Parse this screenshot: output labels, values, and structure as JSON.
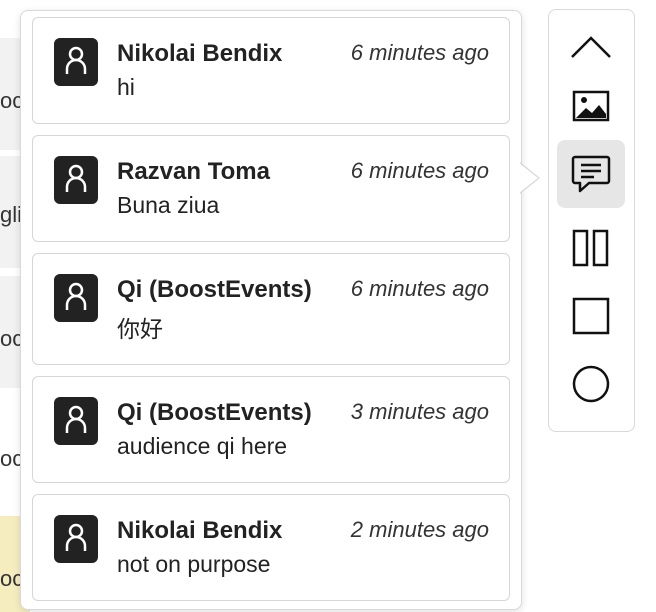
{
  "background": {
    "rows": [
      "oc",
      "gli",
      "oc",
      "oc",
      "oc"
    ]
  },
  "comments": [
    {
      "author": "Nikolai Bendix",
      "time": "6 minutes ago",
      "message": "hi"
    },
    {
      "author": "Razvan Toma",
      "time": "6 minutes ago",
      "message": "Buna ziua"
    },
    {
      "author": "Qi (BoostEvents)",
      "time": "6 minutes ago",
      "message": "你好"
    },
    {
      "author": "Qi (BoostEvents)",
      "time": "3 minutes ago",
      "message": "audience qi here"
    },
    {
      "author": "Nikolai Bendix",
      "time": "2 minutes ago",
      "message": "not on purpose"
    }
  ],
  "toolbar": {
    "items": [
      {
        "icon": "chevron-up-icon"
      },
      {
        "icon": "image-icon"
      },
      {
        "icon": "comment-icon",
        "active": true
      },
      {
        "icon": "columns-icon"
      },
      {
        "icon": "square-icon"
      },
      {
        "icon": "circle-icon"
      }
    ]
  },
  "colors": {
    "avatar": "#222222",
    "active_tool_bg": "#e6e6e6",
    "highlight_row": "#f6edbf"
  }
}
